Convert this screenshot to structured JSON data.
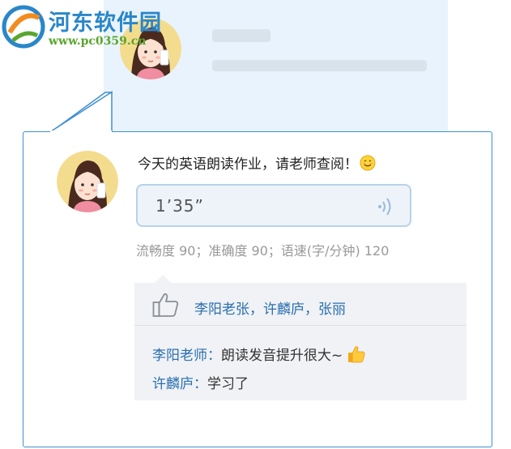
{
  "background_card": {},
  "watermark": {
    "title": "河东软件园",
    "url": "www.pc0359.cn"
  },
  "post": {
    "text": "今天的英语朗读作业，请老师查阅！",
    "voice_duration": "1’35”",
    "scores": "流畅度 90；准确度 90；语速(字/分钟) 120"
  },
  "likes": {
    "names": "李阳老张，许麟庐，张丽"
  },
  "comments": [
    {
      "author": "李阳老师：",
      "text": "朗读发音提升很大~"
    },
    {
      "author": "许麟庐：",
      "text": "学习了"
    }
  ],
  "colors": {
    "accent": "#3d8fd0",
    "link": "#2a6fb0",
    "bg_card": "#e8f3fd",
    "social_bg": "#f0f2f5"
  }
}
